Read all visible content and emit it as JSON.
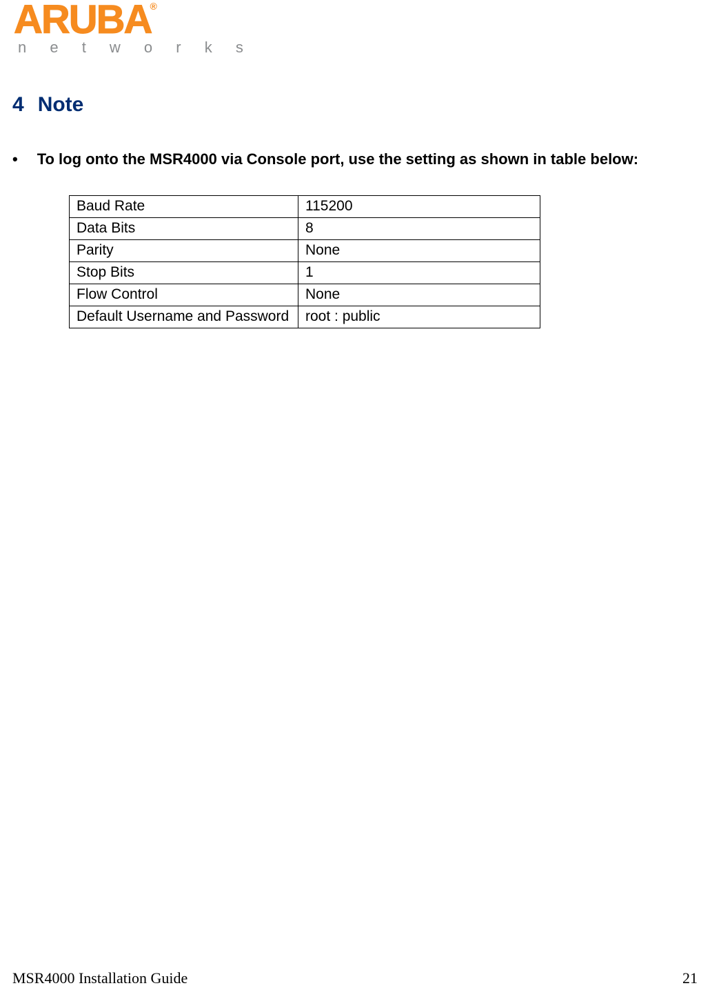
{
  "logo": {
    "main": "ARUBA",
    "reg": "®",
    "sub": "n e t w o r k s"
  },
  "heading": {
    "num": "4",
    "text": "Note"
  },
  "bullet": {
    "marker": "•",
    "text": "To log onto the MSR4000 via Console port, use the setting as shown in table below:"
  },
  "table": {
    "rows": [
      {
        "label": "Baud Rate",
        "value": "115200"
      },
      {
        "label": "Data Bits",
        "value": "8"
      },
      {
        "label": "Parity",
        "value": "None"
      },
      {
        "label": "Stop Bits",
        "value": "1"
      },
      {
        "label": "Flow Control",
        "value": "None"
      },
      {
        "label": "Default Username and Password",
        "value": "root : public"
      }
    ]
  },
  "footer": {
    "title": "MSR4000 Installation Guide",
    "page": "21"
  }
}
